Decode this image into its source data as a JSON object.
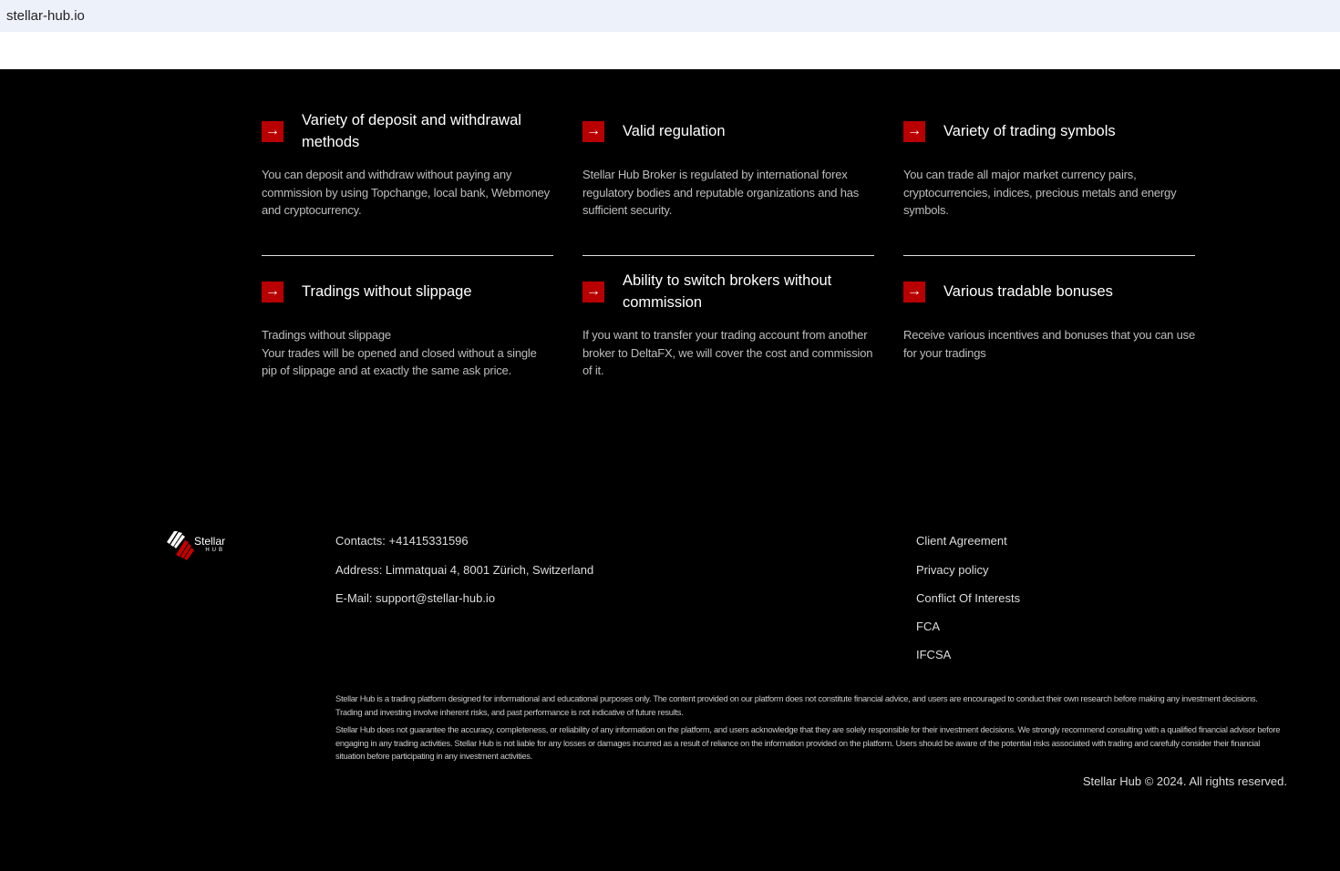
{
  "browser": {
    "url": "stellar-hub.io"
  },
  "features": [
    {
      "title": "Variety of deposit and withdrawal methods",
      "desc": "You can deposit and withdraw without paying any commission by using Topchange, local bank, Webmoney and cryptocurrency."
    },
    {
      "title": "Valid regulation",
      "desc": "Stellar Hub Broker is regulated by international forex regulatory bodies and reputable organizations and has sufficient security."
    },
    {
      "title": "Variety of trading symbols",
      "desc": "You can trade all major market currency pairs, cryptocurrencies, indices, precious metals and energy symbols."
    },
    {
      "title": "Tradings without slippage",
      "desc": "Tradings without slippage\nYour trades will be opened and closed without a single pip of slippage and at exactly the same ask price."
    },
    {
      "title": "Ability to switch brokers without commission",
      "desc": "If you want to transfer your trading account from another broker to DeltaFX, we will cover the cost and commission of it."
    },
    {
      "title": "Various tradable bonuses",
      "desc": "Receive various incentives and bonuses that you can use for your tradings"
    }
  ],
  "footer": {
    "logo": {
      "name": "Stellar",
      "sub": "HUB"
    },
    "contacts": "Contacts: +41415331596",
    "address": "Address: Limmatquai 4, 8001 Zürich, Switzerland",
    "email": "E-Mail: support@stellar-hub.io",
    "links": [
      "Client Agreement",
      "Privacy policy",
      "Conflict Of Interests",
      "FCA",
      "IFCSA"
    ],
    "disclaimer": [
      "Stellar Hub is a trading platform designed for informational and educational purposes only. The content provided on our platform does not constitute financial advice, and users are encouraged to conduct their own research before making any investment decisions. Trading and investing involve inherent risks, and past performance is not indicative of future results.",
      "Stellar Hub does not guarantee the accuracy, completeness, or reliability of any information on the platform, and users acknowledge that they are solely responsible for their investment decisions. We strongly recommend consulting with a qualified financial advisor before engaging in any trading activities. Stellar Hub is not liable for any losses or damages incurred as a result of reliance on the information provided on the platform. Users should be aware of the potential risks associated with trading and carefully consider their financial situation before participating in any investment activities."
    ],
    "copyright": "Stellar Hub © 2024. All rights reserved."
  },
  "colors": {
    "accent": "#b80000"
  }
}
